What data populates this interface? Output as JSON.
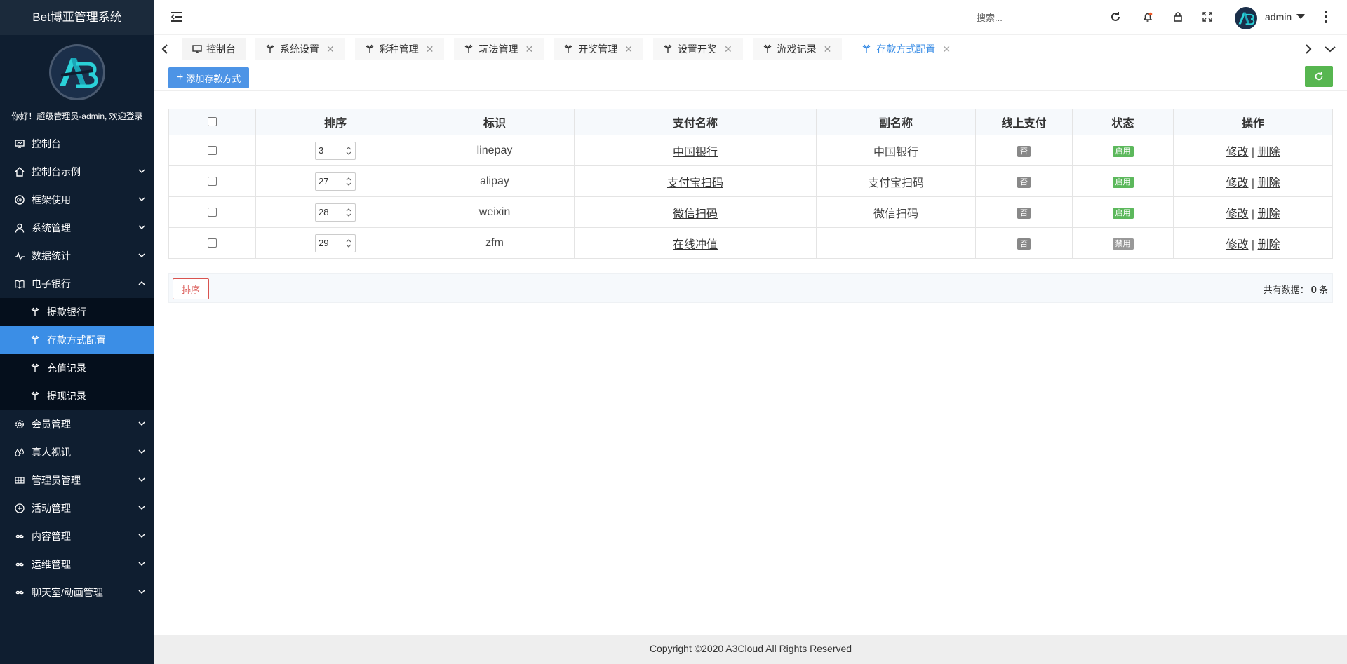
{
  "brand": {
    "title": "Bet博亚管理系统"
  },
  "sidebar": {
    "welcome": "你好！超级管理员-admin, 欢迎登录",
    "menu": [
      {
        "label": "控制台",
        "icon": "monitor-icon",
        "has_children": false
      },
      {
        "label": "控制台示例",
        "icon": "home-icon",
        "has_children": true
      },
      {
        "label": "框架使用",
        "icon": "ok-icon",
        "has_children": true
      },
      {
        "label": "系统管理",
        "icon": "user-icon",
        "has_children": true
      },
      {
        "label": "数据统计",
        "icon": "pulse-icon",
        "has_children": true
      },
      {
        "label": "电子银行",
        "icon": "book-icon",
        "has_children": true,
        "expanded": true
      },
      {
        "label": "会员管理",
        "icon": "gear-icon",
        "has_children": true
      },
      {
        "label": "真人视讯",
        "icon": "drops-icon",
        "has_children": true
      },
      {
        "label": "管理员管理",
        "icon": "grid-icon",
        "has_children": true
      },
      {
        "label": "活动管理",
        "icon": "plus-circle-icon",
        "has_children": true
      },
      {
        "label": "内容管理",
        "icon": "infinity-icon",
        "has_children": true
      },
      {
        "label": "运维管理",
        "icon": "infinity-icon",
        "has_children": true
      },
      {
        "label": "聊天室/动画管理",
        "icon": "infinity-icon",
        "has_children": true
      }
    ],
    "submenu": [
      {
        "label": "提款银行",
        "active": false
      },
      {
        "label": "存款方式配置",
        "active": true
      },
      {
        "label": "充值记录",
        "active": false
      },
      {
        "label": "提现记录",
        "active": false
      }
    ]
  },
  "header": {
    "search_placeholder": "搜索...",
    "username": "admin"
  },
  "tabs": [
    {
      "label": "控制台",
      "closable": false,
      "active": false
    },
    {
      "label": "系统设置",
      "closable": true,
      "active": false
    },
    {
      "label": "彩种管理",
      "closable": true,
      "active": false
    },
    {
      "label": "玩法管理",
      "closable": true,
      "active": false
    },
    {
      "label": "开奖管理",
      "closable": true,
      "active": false
    },
    {
      "label": "设置开奖",
      "closable": true,
      "active": false
    },
    {
      "label": "游戏记录",
      "closable": true,
      "active": false
    },
    {
      "label": "存款方式配置",
      "closable": true,
      "active": true
    }
  ],
  "toolbar": {
    "add_label": "添加存款方式"
  },
  "table": {
    "columns": [
      "排序",
      "标识",
      "支付名称",
      "副名称",
      "线上支付",
      "状态",
      "操作"
    ],
    "rows": [
      {
        "sort": "3",
        "code": "linepay",
        "name": "中国银行",
        "alias": "中国银行",
        "online": "否",
        "status": "启用",
        "status_on": true
      },
      {
        "sort": "27",
        "code": "alipay",
        "name": "支付宝扫码",
        "alias": "支付宝扫码",
        "online": "否",
        "status": "启用",
        "status_on": true
      },
      {
        "sort": "28",
        "code": "weixin",
        "name": "微信扫码",
        "alias": "微信扫码",
        "online": "否",
        "status": "启用",
        "status_on": true
      },
      {
        "sort": "29",
        "code": "zfm",
        "name": "在线冲值",
        "alias": "",
        "online": "否",
        "status": "禁用",
        "status_on": false
      }
    ],
    "action_edit": "修改",
    "action_sep": "|",
    "action_delete": "删除"
  },
  "footer_bar": {
    "sort_label": "排序",
    "total_prefix": "共有数据：",
    "total_count": "0",
    "total_suffix": "条"
  },
  "copyright": "Copyright ©2020 A3Cloud All Rights Reserved",
  "colors": {
    "sidebar_bg": "#0f1e30",
    "active_blue": "#3b8ee6",
    "enabled_green": "#5cb85c",
    "disabled_gray": "#999999",
    "no_gray": "#888888"
  }
}
